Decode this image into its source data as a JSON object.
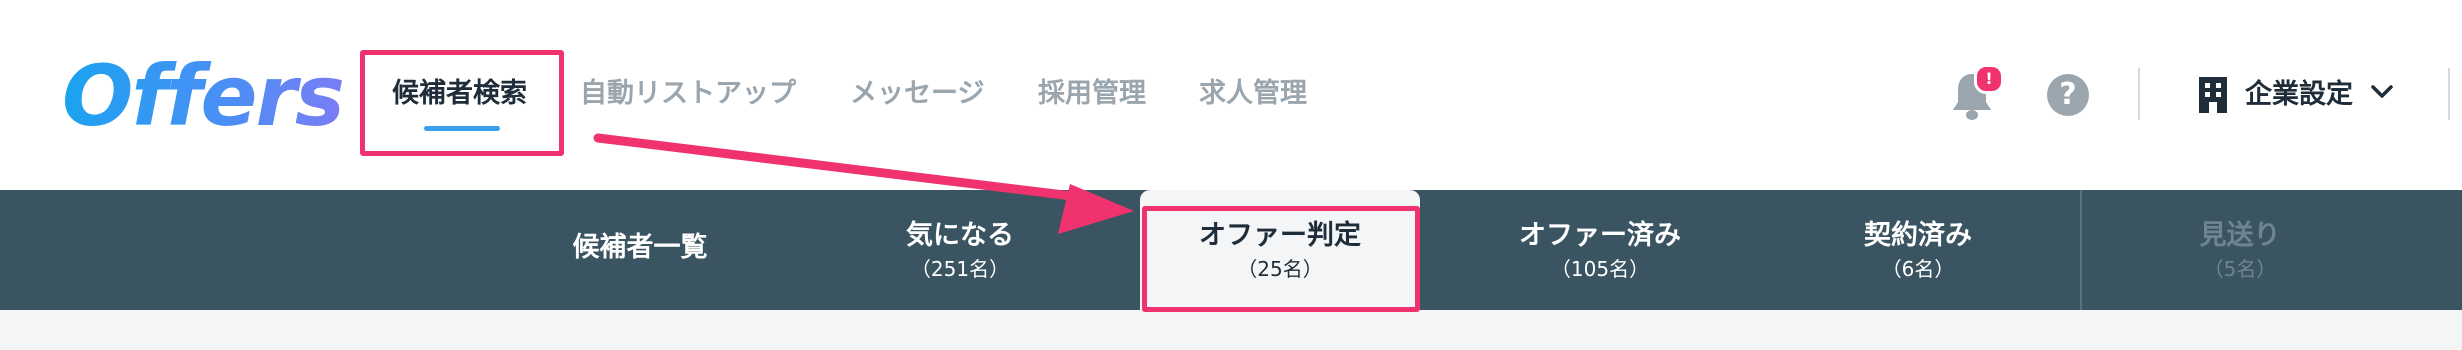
{
  "header": {
    "logo_text": "Offers",
    "nav": [
      {
        "label": "候補者検索",
        "active": true
      },
      {
        "label": "自動リストアップ",
        "active": false
      },
      {
        "label": "メッセージ",
        "active": false
      },
      {
        "label": "採用管理",
        "active": false
      },
      {
        "label": "求人管理",
        "active": false
      }
    ],
    "notification_badge": "!",
    "help_glyph": "?",
    "company_settings_label": "企業設定"
  },
  "tabs": [
    {
      "label": "候補者一覧",
      "count": ""
    },
    {
      "label": "気になる",
      "count": "（251名）"
    },
    {
      "label": "オファー判定",
      "count": "（25名）",
      "active": true
    },
    {
      "label": "オファー済み",
      "count": "（105名）"
    },
    {
      "label": "契約済み",
      "count": "（6名）"
    },
    {
      "label": "見送り",
      "count": "（5名）"
    }
  ],
  "colors": {
    "accent_blue": "#3aa0ee",
    "highlight_pink": "#f0336f",
    "tabbar_bg": "#3a5561",
    "text_dark": "#1f2d3a",
    "text_muted": "#9aa5ad"
  },
  "icons": [
    "bell-icon",
    "help-icon",
    "building-icon",
    "chevron-down-icon",
    "annotation-arrow"
  ]
}
